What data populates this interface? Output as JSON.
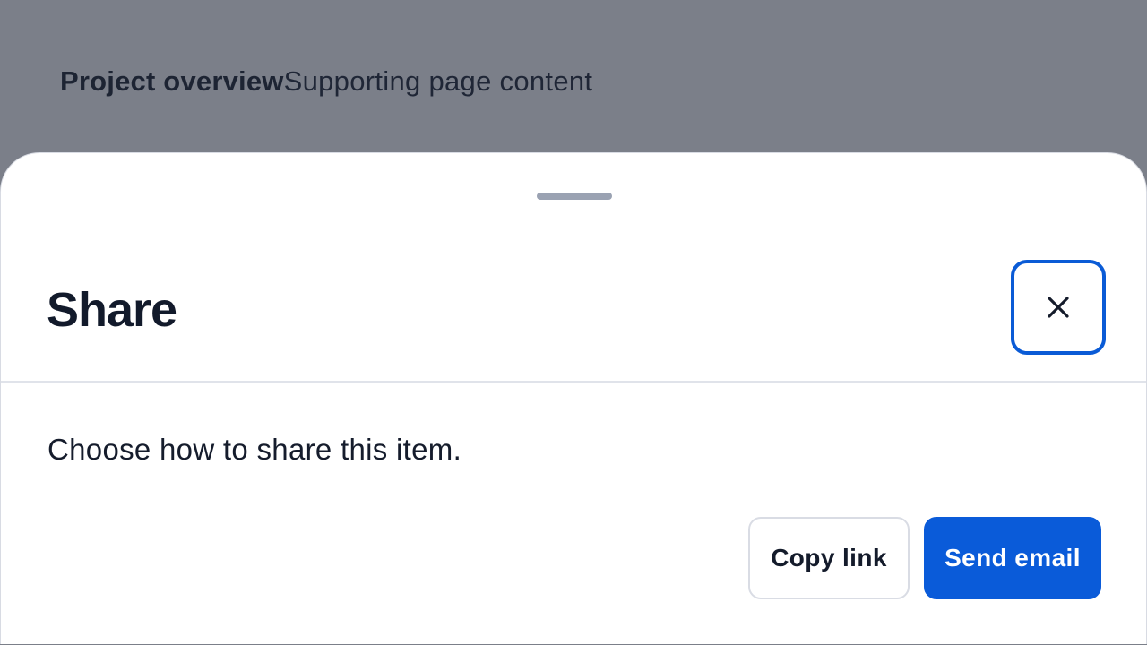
{
  "background": {
    "title": "Project overview",
    "subtitle": "Supporting page content"
  },
  "sheet": {
    "title": "Share",
    "description": "Choose how to share this item.",
    "close_icon": "close-icon",
    "actions": {
      "copy_link_label": "Copy link",
      "send_email_label": "Send email"
    }
  },
  "colors": {
    "overlay": "#7b7f89",
    "accent": "#0a5bd9",
    "text": "#121a2b",
    "border": "#d9dce4"
  }
}
